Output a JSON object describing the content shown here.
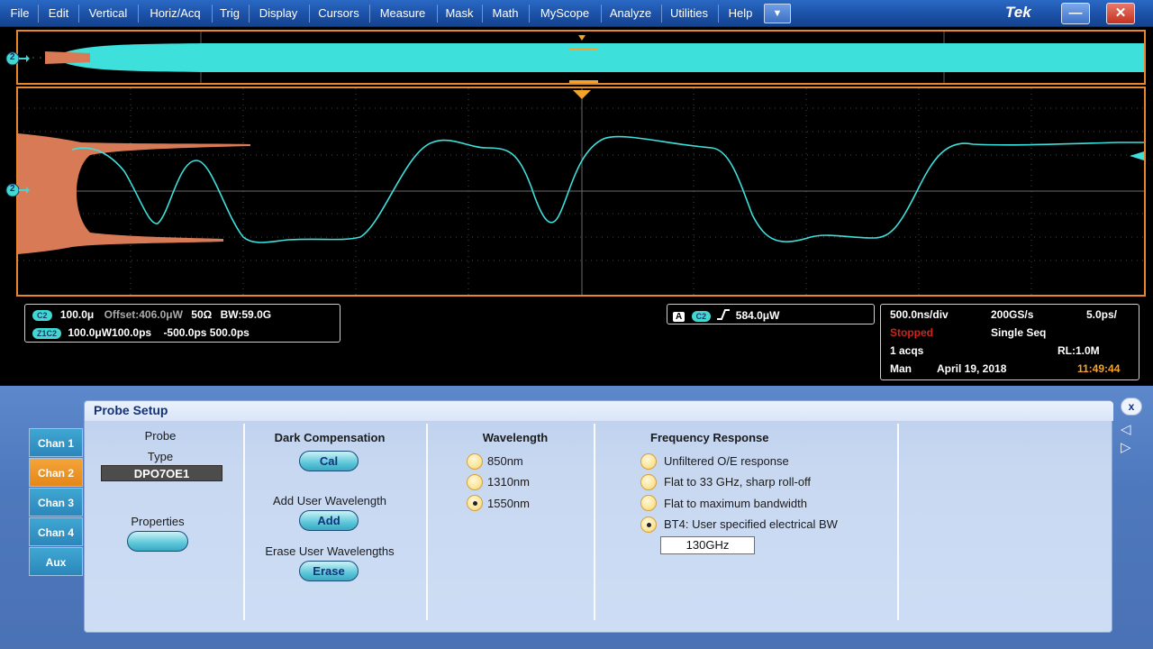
{
  "menu": {
    "items": [
      "File",
      "Edit",
      "Vertical",
      "Horiz/Acq",
      "Trig",
      "Display",
      "Cursors",
      "Measure",
      "Mask",
      "Math",
      "MyScope",
      "Analyze",
      "Utilities",
      "Help"
    ],
    "dropdown_glyph": "▼",
    "brand": "Tek",
    "minimize_glyph": "—",
    "close_glyph": "✕"
  },
  "colors": {
    "trace": "#3ee0dc",
    "histogram": "#d77a55",
    "graticule_border": "#e8862c",
    "marker": "#f2a329",
    "channel_tab_active": "#f5a53a",
    "channel_tab": "#3fa7d2"
  },
  "markers": {
    "channel_ref": "2"
  },
  "readout": {
    "ch_badge": "C2",
    "ch_scale": "100.0μ",
    "ch_offset": "Offset:406.0μW",
    "ch_term": "50Ω",
    "ch_bw": "BW:59.0G",
    "zoom_badge": "Z1C2",
    "zoom_scale": "100.0μW100.0ps",
    "zoom_pos": "-500.0ps 500.0ps",
    "trig_source_badge": "A",
    "trig_channel_badge": "C2",
    "trig_slope_icon": "rising-edge-icon",
    "trig_level": "584.0μW",
    "time_div": "500.0ns/div",
    "sample_rate": "200GS/s",
    "resolution": "5.0ps/",
    "run_state": "Stopped",
    "acq_mode": "Single Seq",
    "acq_count": "1 acqs",
    "record_length": "RL:1.0M",
    "trigger_mode": "Man",
    "date": "April 19, 2018",
    "time": "11:49:44"
  },
  "probe_setup": {
    "title": "Probe Setup",
    "channel_tabs": [
      "Chan 1",
      "Chan 2",
      "Chan 3",
      "Chan 4",
      "Aux"
    ],
    "active_tab": "Chan 2",
    "probe_heading": "Probe",
    "type_label": "Type",
    "type_value": "DPO7OE1",
    "properties_label": "Properties",
    "dark_comp_heading": "Dark Compensation",
    "cal_button": "Cal",
    "add_wavelength_heading": "Add User Wavelength",
    "add_button": "Add",
    "erase_heading": "Erase User Wavelengths",
    "erase_button": "Erase",
    "wavelength_heading": "Wavelength",
    "wavelengths": [
      "850nm",
      "1310nm",
      "1550nm"
    ],
    "selected_wavelength": "1550nm",
    "freq_heading": "Frequency Response",
    "freq_options": [
      "Unfiltered O/E response",
      "Flat to 33 GHz, sharp roll-off",
      "Flat to maximum bandwidth",
      "BT4: User specified electrical BW"
    ],
    "selected_freq": "BT4: User specified electrical BW",
    "user_bw_value": "130GHz",
    "close_glyph": "x",
    "prev_glyph": "◁",
    "next_glyph": "▷"
  }
}
